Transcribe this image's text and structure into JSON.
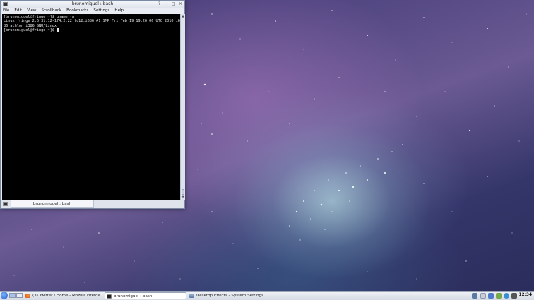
{
  "window": {
    "title": "brunomiguel : bash",
    "menu": [
      "File",
      "Edit",
      "View",
      "Scrollback",
      "Bookmarks",
      "Settings",
      "Help"
    ],
    "terminal_lines": [
      "[brunomiguel@fringe ~]$ uname -a",
      "Linux fringe 2.6.31.12-174.2.22.fc12.i686 #1 SMP Fri Feb 19 19:26:06 UTC 2010 i6",
      "86 athlon i386 GNU/Linux",
      "[brunomiguel@fringe ~]$ "
    ],
    "tab_label": "brunomiguel : bash"
  },
  "taskbar": {
    "tasks": [
      {
        "label": "(3) Twitter / Home - Mozilla Firefox",
        "icon": "firefox-icon",
        "active": false
      },
      {
        "label": "brunomiguel : bash",
        "icon": "terminal-icon",
        "active": true
      },
      {
        "label": "Desktop Effects - System Settings",
        "icon": "settings-icon",
        "active": false
      }
    ],
    "clock": "12:34"
  },
  "colors": {
    "terminal_bg": "#000000",
    "terminal_fg": "#e6e6e6",
    "accent": "#1c5cc8"
  }
}
